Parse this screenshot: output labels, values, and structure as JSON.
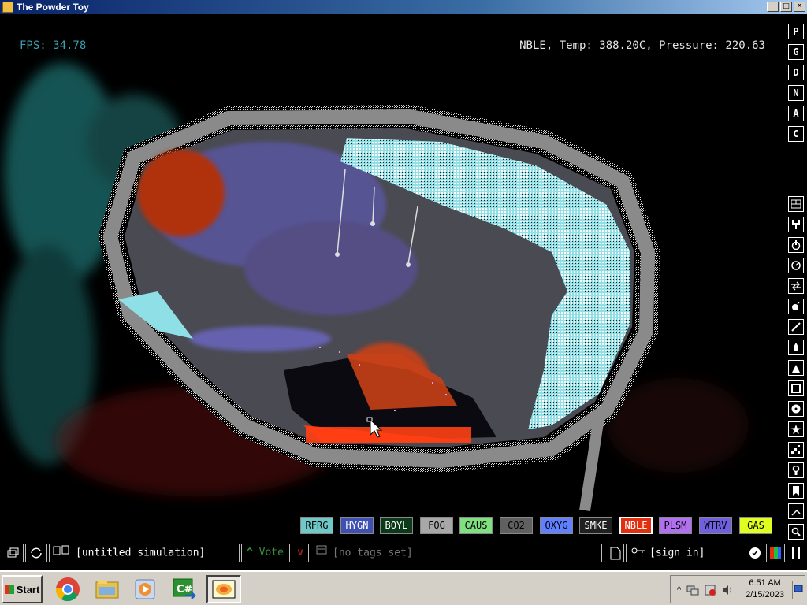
{
  "window": {
    "title": "The Powder Toy"
  },
  "hud": {
    "fps": "FPS: 34.78",
    "info": "NBLE, Temp: 388.20C, Pressure: 220.63"
  },
  "right_menu_letters": [
    "P",
    "G",
    "D",
    "N",
    "A",
    "C"
  ],
  "right_tools": [
    "walls-icon",
    "electronics-icon",
    "powered-icon",
    "sensors-icon",
    "force-icon",
    "explosives-icon",
    "gases-icon",
    "liquids-icon",
    "powders-icon",
    "solids-icon",
    "radioactive-icon",
    "special-icon",
    "life-icon",
    "tools-icon",
    "favorites-icon",
    "decoration-icon",
    "search-icon"
  ],
  "elements": [
    {
      "label": "RFRG",
      "bg": "#70c8c8",
      "fg": "#000000"
    },
    {
      "label": "HYGN",
      "bg": "#4050b0",
      "fg": "#ffffff"
    },
    {
      "label": "BOYL",
      "bg": "#0a3a18",
      "fg": "#ffffff"
    },
    {
      "label": "FOG",
      "bg": "#a8a8a8",
      "fg": "#000000"
    },
    {
      "label": "CAUS",
      "bg": "#80e080",
      "fg": "#000000"
    },
    {
      "label": "CO2",
      "bg": "#606060",
      "fg": "#000000"
    },
    {
      "label": "OXYG",
      "bg": "#6080ff",
      "fg": "#000000"
    },
    {
      "label": "SMKE",
      "bg": "#202020",
      "fg": "#ffffff"
    },
    {
      "label": "NBLE",
      "bg": "#e03010",
      "fg": "#ffffff",
      "selected": true
    },
    {
      "label": "PLSM",
      "bg": "#b070f0",
      "fg": "#000000"
    },
    {
      "label": "WTRV",
      "bg": "#7060e0",
      "fg": "#000000"
    },
    {
      "label": "GAS",
      "bg": "#e0ff20",
      "fg": "#000000"
    }
  ],
  "bottombar": {
    "save_name": "[untitled simulation]",
    "vote_label": "Vote",
    "tags": "[no tags set]",
    "signin": "[sign in]"
  },
  "taskbar": {
    "start_label": "Start",
    "apps": [
      "chrome-icon",
      "explorer-icon",
      "media-player-icon",
      "csharp-icon",
      "powder-toy-icon"
    ],
    "clock_time": "6:51 AM",
    "clock_date": "2/15/2023"
  }
}
